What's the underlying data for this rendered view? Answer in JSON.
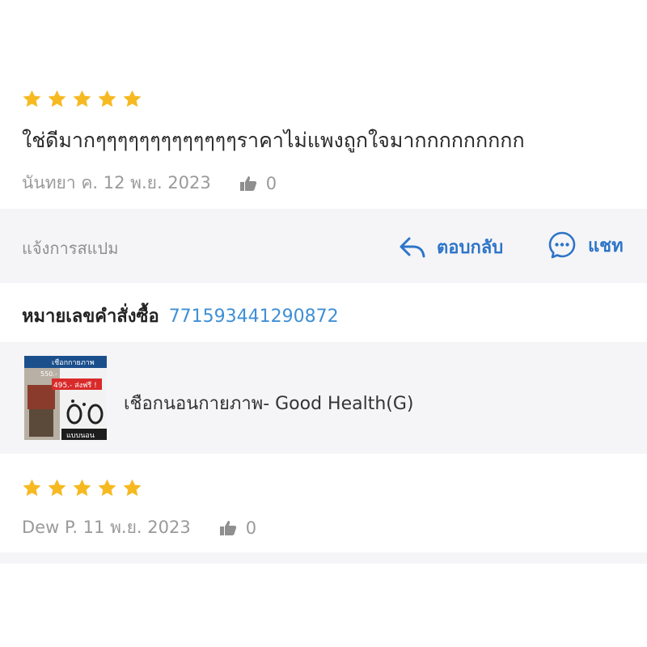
{
  "colors": {
    "star": "#f6b921",
    "link": "#2d74c9",
    "order_number": "#3f8fd6",
    "band_bg": "#f5f5f7",
    "muted": "#9a9a9a"
  },
  "review1": {
    "rating": 5,
    "text": "ใช่ดีมากๆๆๆๆๆๆๆๆๆๆๆๆๆราคาไม่แพงถูกใจมากกกกกกกกก",
    "author_date": "นันทยา ค. 12 พ.ย. 2023",
    "likes": "0"
  },
  "actions": {
    "report_spam": "แจ้งการสแปม",
    "reply": "ตอบกลับ",
    "chat": "แชท",
    "reply_icon": "reply-arrow-icon",
    "chat_icon": "chat-bubble-icon"
  },
  "order": {
    "label": "หมายเลขคำสั่งซื้อ",
    "number": "771593441290872"
  },
  "product": {
    "name": "เชือกนอนกายภาพ- Good Health(G)",
    "thumb_texts": [
      "เชือกกายภาพ",
      "550.-",
      "495.- ส่งฟรี !",
      "แบบนอน"
    ]
  },
  "review2": {
    "rating": 5,
    "author_date": "Dew P. 11 พ.ย. 2023",
    "likes": "0"
  }
}
